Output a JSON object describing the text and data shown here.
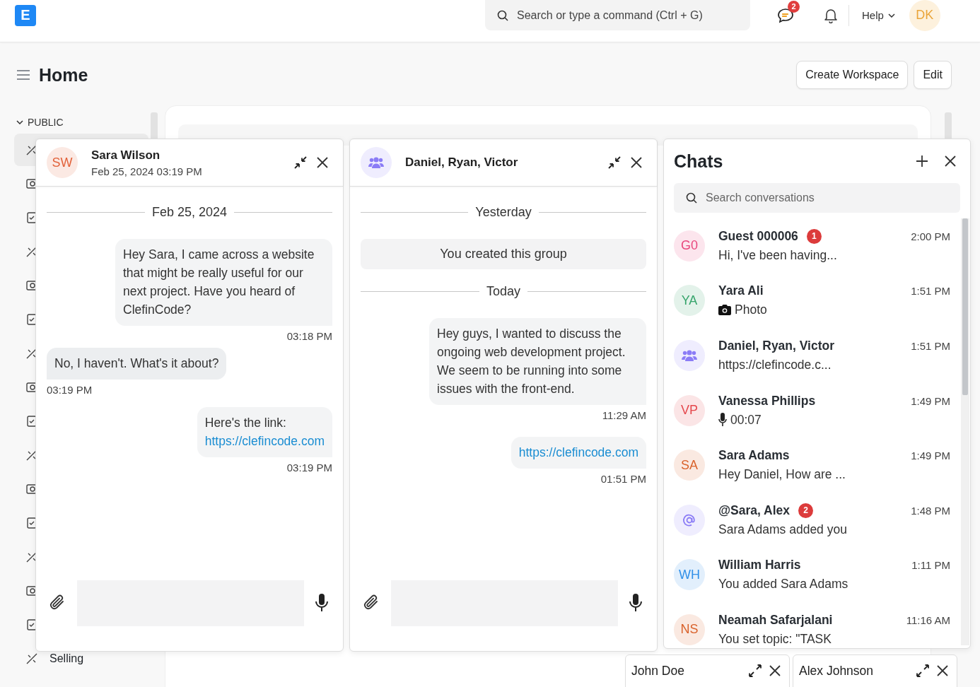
{
  "navbar": {
    "logo_letter": "E",
    "search": {
      "placeholder": "Search or type a command (Ctrl + G)"
    },
    "chat_badge": "2",
    "help": "Help",
    "avatar": "DK"
  },
  "page": {
    "title": "Home",
    "buttons": [
      "Create Workspace",
      "Edit"
    ]
  },
  "sidebar": {
    "section": "PUBLIC",
    "expanded": true,
    "items": [
      {
        "selected": true
      },
      {
        "selected": false
      },
      {
        "selected": false
      },
      {
        "selected": false
      },
      {
        "selected": false
      },
      {
        "selected": false
      },
      {
        "selected": false
      },
      {
        "selected": false
      },
      {
        "selected": false
      },
      {
        "selected": false
      },
      {
        "selected": false
      },
      {
        "selected": false
      },
      {
        "selected": false
      },
      {
        "selected": false
      },
      {
        "selected": false
      },
      {
        "selected": false,
        "label": "Selling"
      }
    ]
  },
  "chat_windows": [
    {
      "name": "Sara Wilson",
      "subtitle": "Feb 25, 2024 03:19 PM",
      "avatar": {
        "kind": "initials",
        "text": "SW",
        "color": "#e2623a"
      },
      "messages": [
        {
          "kind": "divider",
          "text": "Feb 25, 2024"
        },
        {
          "kind": "outgoing",
          "text": "Hey Sara, I came across a website that might be really useful for our next project. Have you heard of ClefinCode?",
          "time": "03:18 PM"
        },
        {
          "kind": "incoming",
          "text": "No, I haven't. What's it about?",
          "time": "03:19 PM"
        },
        {
          "kind": "outgoing",
          "text": "Here's the link:",
          "link": "https://clefincode.com",
          "time": "03:19 PM"
        }
      ]
    },
    {
      "name": "Daniel, Ryan, Victor",
      "avatar": {
        "kind": "group",
        "color": "#8b7cf6"
      },
      "messages": [
        {
          "kind": "divider",
          "text": "Yesterday"
        },
        {
          "kind": "system",
          "text": "You created this group"
        },
        {
          "kind": "divider",
          "text": "Today"
        },
        {
          "kind": "outgoing",
          "text": "Hey guys, I wanted to discuss the ongoing web development project. We seem to be running into some issues with the front-end.",
          "time": "11:29 AM"
        },
        {
          "kind": "outgoing",
          "link": "https://clefincode.com",
          "time": "01:51 PM"
        }
      ]
    }
  ],
  "chats_panel": {
    "title": "Chats",
    "search": {
      "placeholder": "Search conversations"
    },
    "items": [
      {
        "name": "Guest 000006",
        "badge": "1",
        "time": "2:00 PM",
        "preview": "Hi, I've been having...",
        "avatar": {
          "kind": "initials",
          "text": "G0",
          "color": "#e8467c"
        }
      },
      {
        "name": "Yara Ali",
        "time": "1:51 PM",
        "preview": "Photo",
        "kind": "photo",
        "avatar": {
          "kind": "initials",
          "text": "YA",
          "color": "#36a46b"
        }
      },
      {
        "name": "Daniel, Ryan, Victor",
        "time": "1:51 PM",
        "preview": "https://clefincode.c...",
        "avatar": {
          "kind": "group",
          "color": "#8b7cf6"
        }
      },
      {
        "name": "Vanessa Phillips",
        "time": "1:49 PM",
        "preview": "00:07",
        "kind": "voice",
        "avatar": {
          "kind": "initials",
          "text": "VP",
          "color": "#e5484d"
        }
      },
      {
        "name": "Sara Adams",
        "time": "1:49 PM",
        "preview": "Hey Daniel, How are ...",
        "avatar": {
          "kind": "initials",
          "text": "SA",
          "color": "#d9622b"
        }
      },
      {
        "name": "@Sara, Alex",
        "badge": "2",
        "time": "1:48 PM",
        "preview": "Sara Adams added you",
        "avatar": {
          "kind": "mention",
          "color": "#8b7cf6"
        }
      },
      {
        "name": "William Harris",
        "time": "1:11 PM",
        "preview": "You added Sara Adams",
        "avatar": {
          "kind": "initials",
          "text": "WH",
          "color": "#2f8fe8"
        }
      },
      {
        "name": "Neamah Safarjalani",
        "time": "11:16 AM",
        "preview": "You set topic: \"TASK",
        "avatar": {
          "kind": "initials",
          "text": "NS",
          "color": "#d9622b"
        }
      }
    ]
  },
  "minimized_chats": [
    {
      "name": "John Doe"
    },
    {
      "name": "Alex Johnson"
    }
  ]
}
